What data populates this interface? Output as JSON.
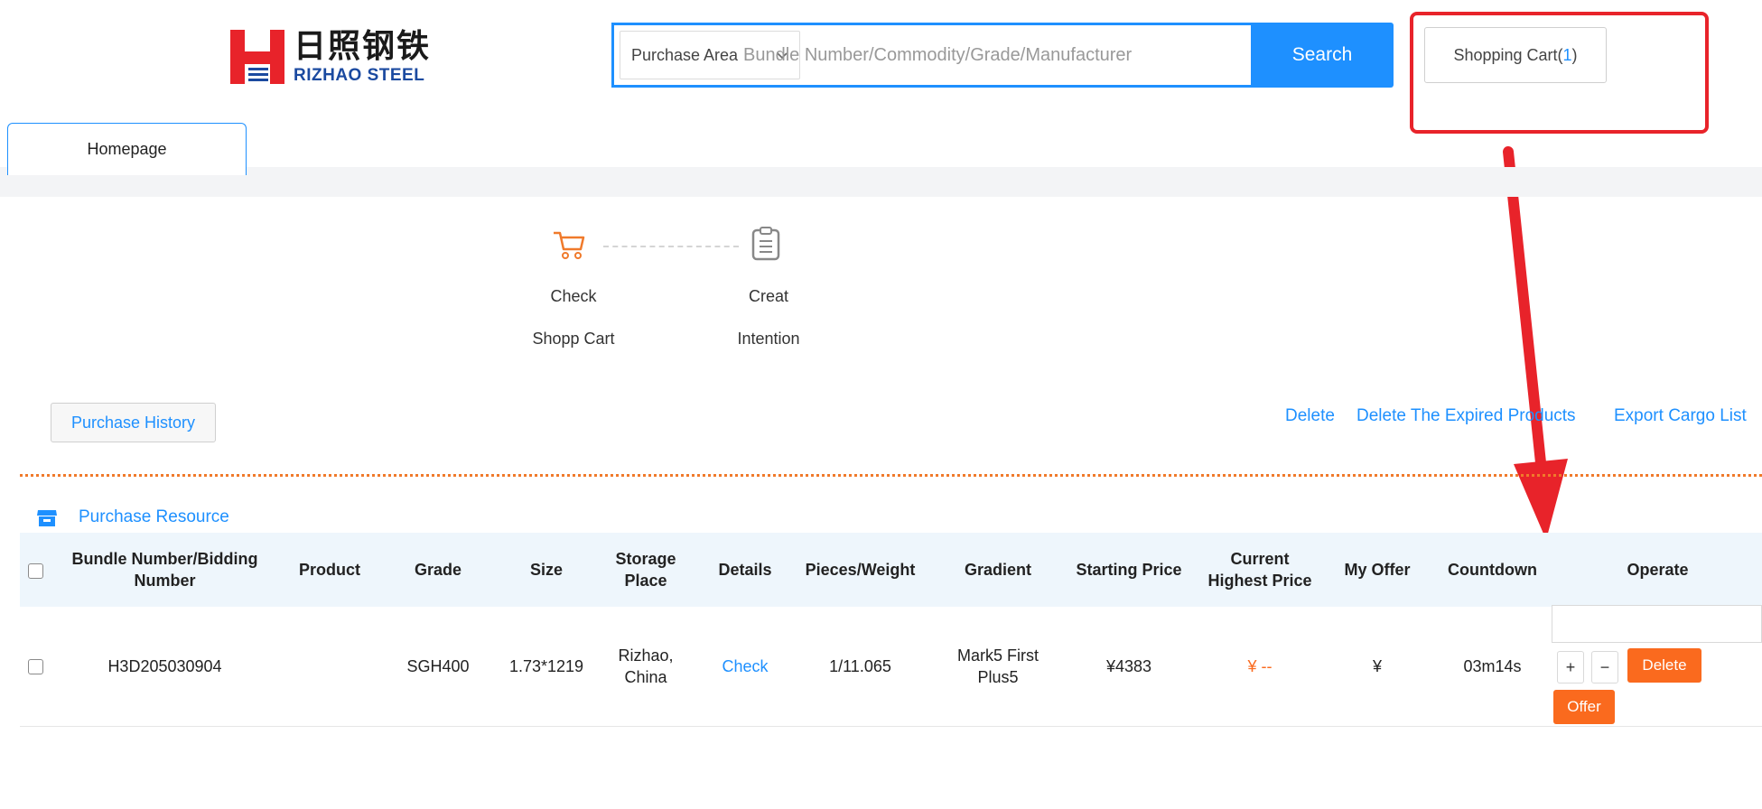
{
  "brand": {
    "name_cn": "日照钢铁",
    "name_en": "RIZHAO STEEL",
    "logo_color": "#e8232a",
    "text_color": "#1b4aa0"
  },
  "header": {
    "search_select": "Purchase Area",
    "search_placeholder": "Bundle Number/Commodity/Grade/Manufacturer",
    "search_button": "Search",
    "cart_label": "Shopping Cart(",
    "cart_count": "1",
    "cart_close": ")"
  },
  "tabs": [
    {
      "label": "Homepage",
      "active": true
    }
  ],
  "steps": [
    {
      "label_line1": "Check",
      "label_line2": "Shopp Cart",
      "icon": "cart-icon",
      "active": true
    },
    {
      "label_line1": "Creat",
      "label_line2": "Intention",
      "icon": "clipboard-icon",
      "active": false
    }
  ],
  "actions": {
    "history_button": "Purchase History",
    "delete": "Delete",
    "delete_expired": "Delete The Expired Products",
    "export": "Export Cargo List"
  },
  "resource": {
    "label": "Purchase Resource",
    "icon": "store-icon"
  },
  "table": {
    "headers": {
      "bundle": [
        "Bundle Number/Bidding",
        "Number"
      ],
      "product": "Product",
      "grade": "Grade",
      "size": "Size",
      "storage": [
        "Storage",
        "Place"
      ],
      "details": "Details",
      "pieces": "Pieces/Weight",
      "gradient": "Gradient",
      "starting": "Starting Price",
      "current": [
        "Current",
        "Highest Price"
      ],
      "offer": "My Offer",
      "countdown": "Countdown",
      "operate": "Operate"
    },
    "rows": [
      {
        "bundle": "H3D205030904",
        "product": "",
        "grade": "SGH400",
        "size": "1.73*1219",
        "storage": [
          "Rizhao,",
          "China"
        ],
        "details": "Check",
        "pieces": "1/11.065",
        "gradient": [
          "Mark5 First",
          "Plus5"
        ],
        "starting": "¥4383",
        "current": "¥ --",
        "offer": "¥",
        "countdown": "03m14s",
        "plus": "+",
        "minus": "−",
        "delete": "Delete",
        "offer_btn": "Offer"
      }
    ]
  },
  "colors": {
    "accent": "#1e90ff",
    "orange": "#fa6a1e",
    "highlight": "#e8232a"
  }
}
